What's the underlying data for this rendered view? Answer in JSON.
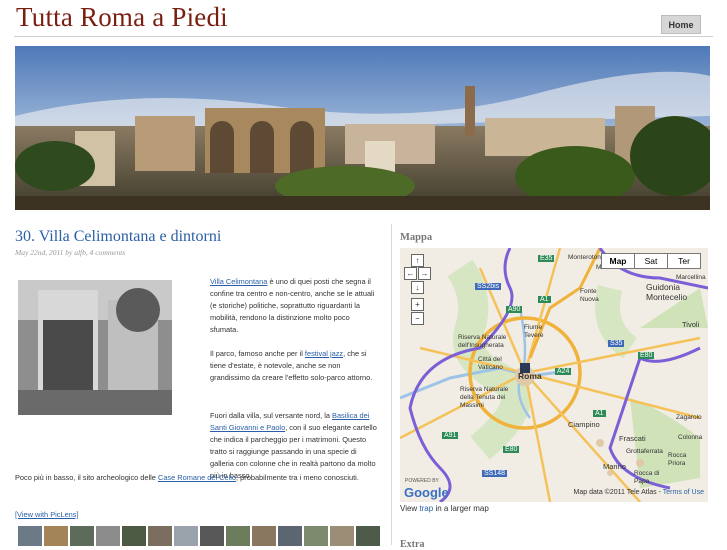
{
  "site": {
    "title": "Tutta Roma a Piedi",
    "nav_home": "Home"
  },
  "post": {
    "title": "30. Villa Celimontana e dintorni",
    "meta": "May 22nd, 2011 by alfb, 4 comments",
    "p1_link": "Villa Celimontana",
    "p1_text": " è uno di quei posti che segna il confine tra centro e non-centro, anche se le attuali (e storiche) politiche, soprattutto riguardanti la mobilità, rendono la distinzione molto poco sfumata.",
    "p2_a": "Il parco, famoso anche per il ",
    "p2_link": "festival jazz",
    "p2_b": ", che si tiene d'estate, è notevole, anche se non grandissimo da creare l'effetto solo-parco attorno.",
    "p3_a": "Fuori dalla villa, sul versante nord, la ",
    "p3_link": "Basilica dei Santi Giovanni e Paolo",
    "p3_b": ", con il suo elegante cartello che indica il parcheggio per i matrimoni. Questo tratto si raggiunge passando in una specie di galleria con colonne che in realtà partono da molto più in basso.",
    "p4_a": "Poco più in basso, il sito archeologico delle ",
    "p4_link": "Case Romane del Celio",
    "p4_b": ", probabilmente tra i meno conosciuti.",
    "piclens": "[View with PicLens]"
  },
  "sidebar": {
    "map_heading": "Mappa",
    "map_types": [
      "Map",
      "Sat",
      "Ter"
    ],
    "map_view_a": "View ",
    "map_view_link": "trap",
    "map_view_b": " in a larger map",
    "attribution": "Map data ©2011 Tele Atlas - ",
    "terms": "Terms of Use",
    "google": "Google",
    "powered_by": "POWERED BY",
    "next_heading": "Extra",
    "places": [
      "Monterotondo",
      "Mentana",
      "Marcellina",
      "Guidonia Montecelio",
      "Tivoli",
      "Fonte Nuova",
      "Riserva Naturale dell'Insugherata",
      "Città del Vaticano",
      "Roma",
      "Fiume Tevere",
      "Riserva Naturale della Tenuta dei Massimi",
      "Ciampino",
      "Frascati",
      "Grottaferrata",
      "Marino",
      "Rocca di Papa",
      "Rocca Priora",
      "Zagarolo",
      "Colonna"
    ],
    "road_labels": [
      "SS2bis",
      "E35",
      "A1",
      "A90",
      "S35",
      "E80",
      "A24",
      "A91",
      "E80",
      "SS148",
      "A1"
    ],
    "nav_icons": [
      "pan-up-icon",
      "pan-left-icon",
      "pan-right-icon",
      "pan-down-icon",
      "zoom-in-icon",
      "zoom-out-icon"
    ]
  },
  "colors": {
    "title": "#7a1e12",
    "link": "#2a5ea6",
    "route": "#7b5fd6",
    "highway": "#f0b23a"
  }
}
